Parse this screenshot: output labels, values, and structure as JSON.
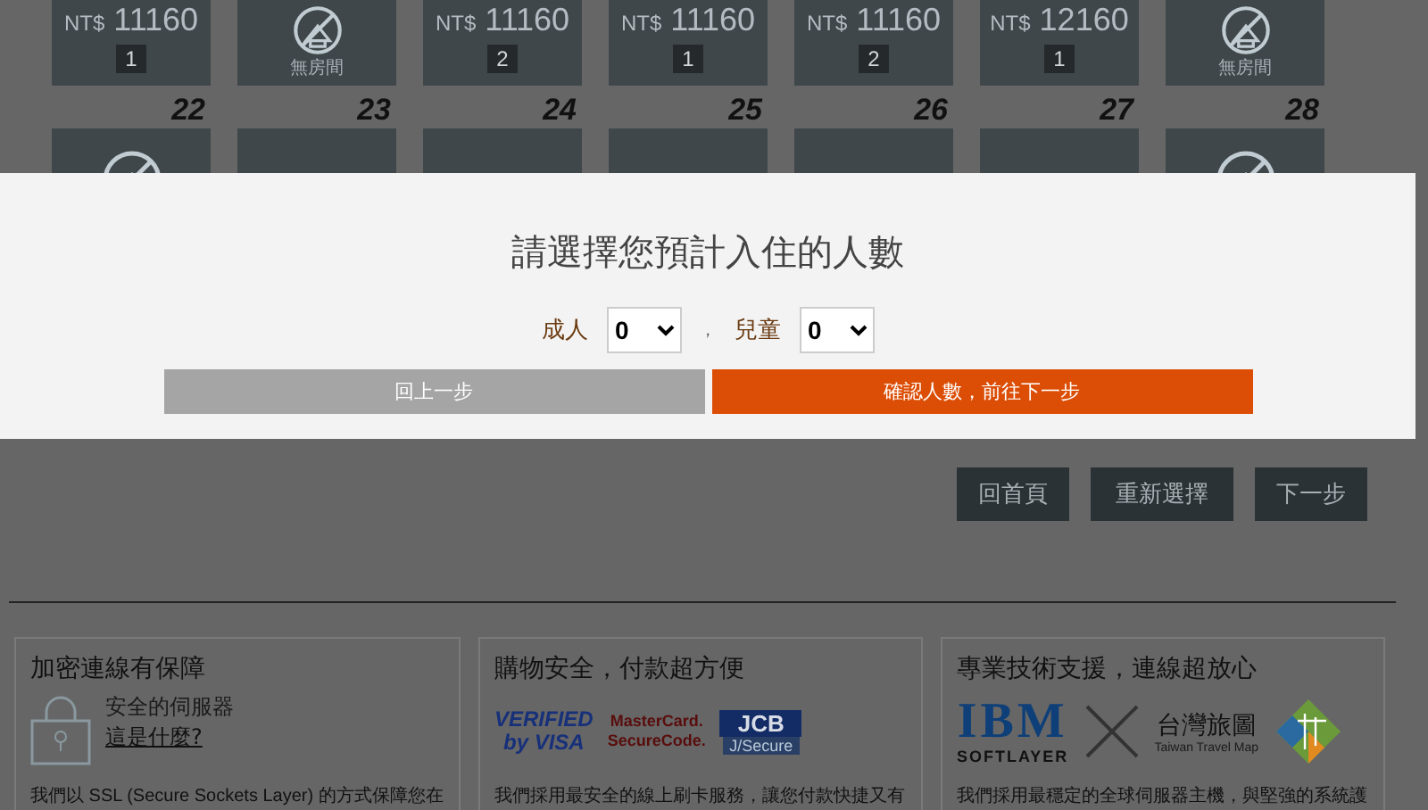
{
  "calendar": {
    "weeks": [
      {
        "days": [
          {
            "kind": "price",
            "currency": "NT$",
            "price": "11160",
            "rooms": "1"
          },
          {
            "kind": "none",
            "label": "無房間"
          },
          {
            "kind": "price",
            "currency": "NT$",
            "price": "11160",
            "rooms": "2"
          },
          {
            "kind": "price",
            "currency": "NT$",
            "price": "11160",
            "rooms": "1"
          },
          {
            "kind": "price",
            "currency": "NT$",
            "price": "11160",
            "rooms": "2"
          },
          {
            "kind": "price",
            "currency": "NT$",
            "price": "12160",
            "rooms": "1"
          },
          {
            "kind": "none",
            "label": "無房間"
          }
        ]
      },
      {
        "days": [
          {
            "kind": "none",
            "day": "22"
          },
          {
            "kind": "price",
            "day": "23"
          },
          {
            "kind": "price",
            "day": "24"
          },
          {
            "kind": "price",
            "day": "25"
          },
          {
            "kind": "price",
            "day": "26"
          },
          {
            "kind": "price",
            "day": "27"
          },
          {
            "kind": "none",
            "day": "28"
          }
        ]
      }
    ]
  },
  "nav_buttons": [
    "回首頁",
    "重新選擇",
    "下一步"
  ],
  "cards": [
    {
      "title": "加密連線有保障",
      "kind": "ssl",
      "server": "安全的伺服器",
      "link": "這是什麼?",
      "text": "我們以 SSL (Secure Sockets Layer) 的方式保障您在"
    },
    {
      "title": "購物安全，付款超方便",
      "kind": "logos",
      "logos": [
        {
          "kind": "visa",
          "lines": [
            "VERIFIED",
            "by VISA"
          ]
        },
        {
          "kind": "mastercard",
          "lines": [
            "MasterCard.",
            "SecureCode."
          ]
        },
        {
          "kind": "jcb",
          "lines": [
            "JCB",
            "J/Secure"
          ]
        }
      ],
      "text": "我們採用最安全的線上刷卡服務，讓您付款快捷又有"
    },
    {
      "title": "專業技術支援，連線超放心",
      "kind": "logos",
      "logos": [
        {
          "kind": "ibm",
          "lines": [
            "IBM",
            "SOFTLAYER"
          ]
        },
        {
          "kind": "cross"
        },
        {
          "kind": "ttm",
          "lines": [
            "台灣旅圖",
            "Taiwan Travel Map"
          ]
        },
        {
          "kind": "ttm-mark"
        }
      ],
      "text": "我們採用最穩定的全球伺服器主機，與堅強的系統護"
    }
  ],
  "modal": {
    "title": "請選擇您預計入住的人數",
    "fields": [
      {
        "label": "成人",
        "value": "0"
      },
      {
        "label": "兒童",
        "value": "0"
      }
    ],
    "separator": "，",
    "back_button": "回上一步",
    "confirm_button": "確認人數，前往下一步"
  }
}
